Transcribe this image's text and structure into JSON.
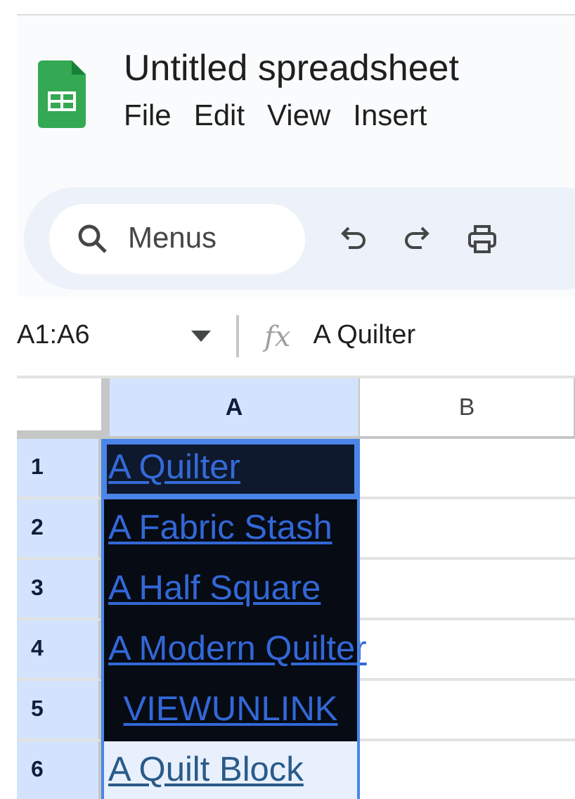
{
  "document": {
    "title": "Untitled spreadsheet"
  },
  "menu": [
    "File",
    "Edit",
    "View",
    "Insert"
  ],
  "toolbar": {
    "search": {
      "placeholder": "Menus"
    }
  },
  "formula_bar": {
    "name_box": "A1:A6",
    "fx": "fx",
    "value": "A Quilter"
  },
  "columns": [
    {
      "label": "A",
      "selected": true
    },
    {
      "label": "B",
      "selected": false
    }
  ],
  "rows": [
    {
      "number": "1",
      "selected": true,
      "active": true,
      "dark": true,
      "centered": false,
      "text": "A Quilter"
    },
    {
      "number": "2",
      "selected": true,
      "active": false,
      "dark": true,
      "centered": false,
      "text": "A Fabric Stash"
    },
    {
      "number": "3",
      "selected": true,
      "active": false,
      "dark": true,
      "centered": false,
      "text": "A Half Square"
    },
    {
      "number": "4",
      "selected": true,
      "active": false,
      "dark": true,
      "centered": false,
      "text": "A Modern Quilter"
    },
    {
      "number": "5",
      "selected": true,
      "active": false,
      "dark": true,
      "centered": true,
      "text": "VIEWUNLINK"
    },
    {
      "number": "6",
      "selected": true,
      "active": false,
      "dark": false,
      "centered": false,
      "text": "A Quilt Block"
    }
  ]
}
